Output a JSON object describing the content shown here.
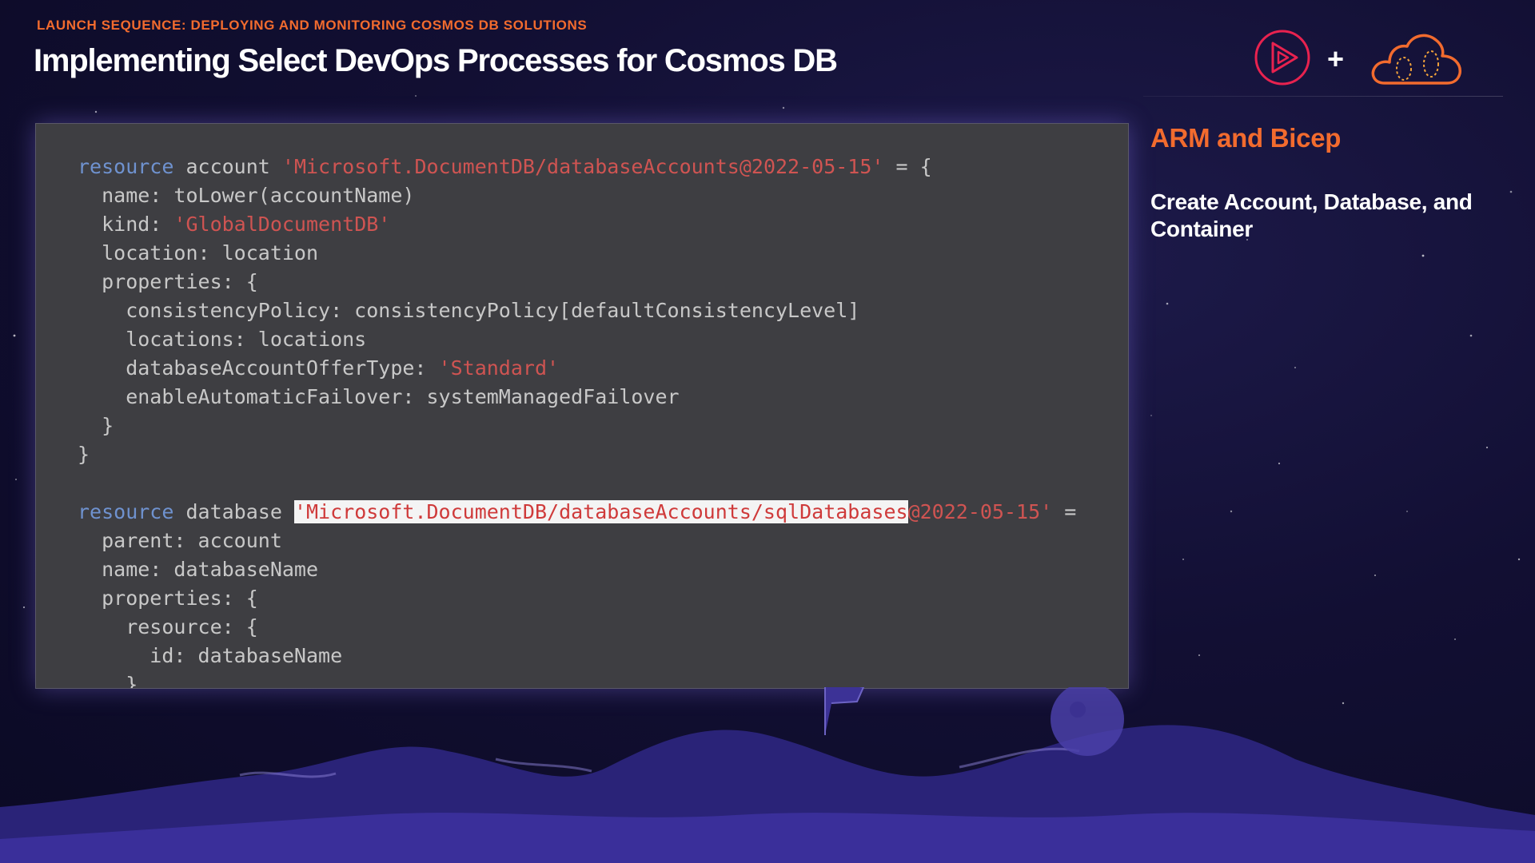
{
  "header": {
    "eyebrow": "LAUNCH SEQUENCE: DEPLOYING AND MONITORING COSMOS DB SOLUTIONS",
    "title": "Implementing Select DevOps Processes for Cosmos DB",
    "plus": "+"
  },
  "sidebar": {
    "heading": "ARM and Bicep",
    "description": "Create Account, Database, and Container"
  },
  "code": {
    "lines": [
      [
        {
          "t": "resource",
          "c": "kw"
        },
        {
          "t": " account ",
          "c": "plain"
        },
        {
          "t": "'Microsoft.DocumentDB/databaseAccounts@2022-05-15'",
          "c": "str"
        },
        {
          "t": " = {",
          "c": "plain"
        }
      ],
      [
        {
          "t": "  name: toLower(accountName)",
          "c": "plain"
        }
      ],
      [
        {
          "t": "  kind: ",
          "c": "plain"
        },
        {
          "t": "'GlobalDocumentDB'",
          "c": "str"
        }
      ],
      [
        {
          "t": "  location: location",
          "c": "plain"
        }
      ],
      [
        {
          "t": "  properties: {",
          "c": "plain"
        }
      ],
      [
        {
          "t": "    consistencyPolicy: consistencyPolicy[defaultConsistencyLevel]",
          "c": "plain"
        }
      ],
      [
        {
          "t": "    locations: locations",
          "c": "plain"
        }
      ],
      [
        {
          "t": "    databaseAccountOfferType: ",
          "c": "plain"
        },
        {
          "t": "'Standard'",
          "c": "str"
        }
      ],
      [
        {
          "t": "    enableAutomaticFailover: systemManagedFailover",
          "c": "plain"
        }
      ],
      [
        {
          "t": "  }",
          "c": "plain"
        }
      ],
      [
        {
          "t": "}",
          "c": "plain"
        }
      ],
      [],
      [
        {
          "t": "resource",
          "c": "kw"
        },
        {
          "t": " database ",
          "c": "plain"
        },
        {
          "t": "'Microsoft.DocumentDB/databaseAccounts/sqlDatabases",
          "c": "hl"
        },
        {
          "t": "@2022-05-15'",
          "c": "str"
        },
        {
          "t": " =",
          "c": "plain"
        }
      ],
      [
        {
          "t": "  parent: account",
          "c": "plain"
        }
      ],
      [
        {
          "t": "  name: databaseName",
          "c": "plain"
        }
      ],
      [
        {
          "t": "  properties: {",
          "c": "plain"
        }
      ],
      [
        {
          "t": "    resource: {",
          "c": "plain"
        }
      ],
      [
        {
          "t": "      id: databaseName",
          "c": "plain"
        }
      ],
      [
        {
          "t": "    }",
          "c": "plain"
        }
      ]
    ]
  },
  "colors": {
    "accent_orange": "#f26b2e",
    "keyword_blue": "#6f92cf",
    "string_red": "#cf5452",
    "code_background": "#3e3e42",
    "highlight_background": "#f4f4f4"
  },
  "icons": {
    "play_logo": "play-triangle-icon",
    "cloud_logo": "cloud-icon"
  }
}
